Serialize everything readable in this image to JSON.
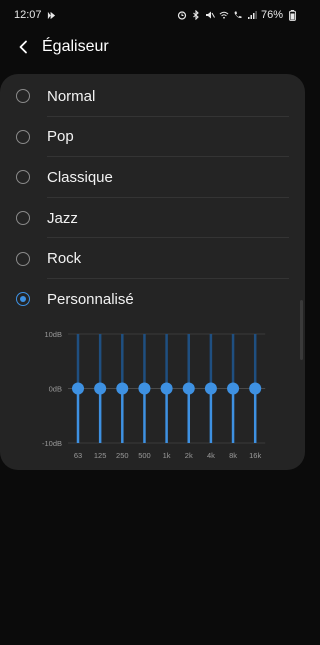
{
  "status_bar": {
    "time": "12:07",
    "battery": "76%",
    "icons": [
      "media-play-icon",
      "alarm-icon",
      "bluetooth-icon",
      "mute-icon",
      "wifi-icon",
      "wifi-call-icon",
      "signal-icon",
      "battery-icon"
    ]
  },
  "header": {
    "title": "Égaliseur",
    "back_icon": "chevron-left-icon"
  },
  "presets": {
    "items": [
      {
        "label": "Normal",
        "selected": false
      },
      {
        "label": "Pop",
        "selected": false
      },
      {
        "label": "Classique",
        "selected": false
      },
      {
        "label": "Jazz",
        "selected": false
      },
      {
        "label": "Rock",
        "selected": false
      },
      {
        "label": "Personnalisé",
        "selected": true
      }
    ]
  },
  "colors": {
    "accent": "#3e91e2",
    "card": "#242424",
    "background": "#0b0b0b"
  },
  "chart_data": {
    "type": "bar",
    "categories": [
      "63",
      "125",
      "250",
      "500",
      "1k",
      "2k",
      "4k",
      "8k",
      "16k"
    ],
    "values": [
      0,
      0,
      0,
      0,
      0,
      0,
      0,
      0,
      0
    ],
    "ylim": [
      -10,
      10
    ],
    "y_ticks": [
      "10dB",
      "0dB",
      "-10dB"
    ],
    "grid": true
  }
}
